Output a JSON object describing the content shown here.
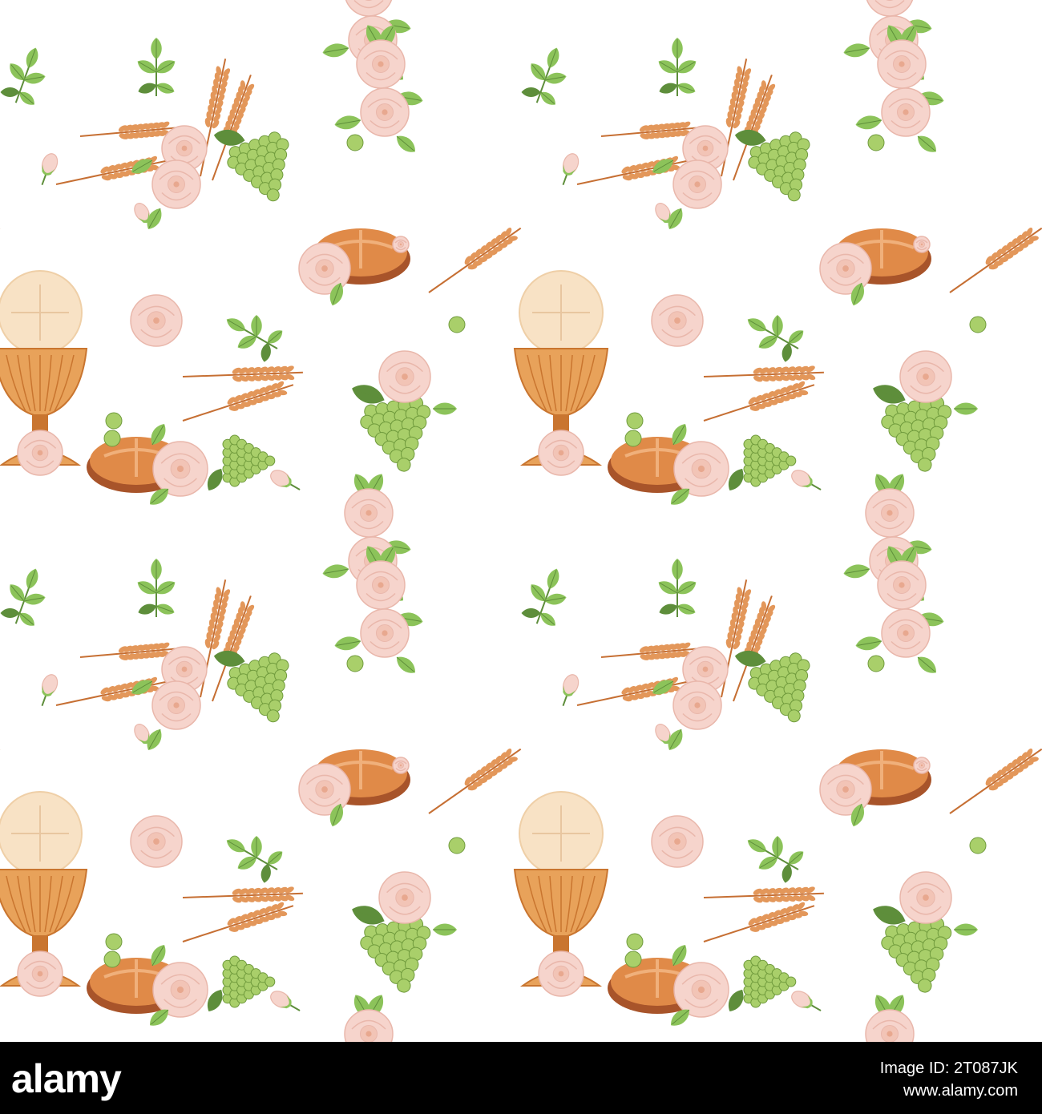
{
  "image": {
    "kind": "seamless-pattern",
    "motifs": [
      "chalice-with-host",
      "rose-bouquet",
      "bread-loaf",
      "wheat-ear",
      "grape-bunch",
      "rose-bud",
      "leaf-sprig",
      "single-grape"
    ]
  },
  "colors": {
    "background": "#ffffff",
    "rose": "#f6d4cc",
    "rose_shade": "#e9b7ab",
    "leaf": "#8cc35a",
    "leaf_dark": "#5e8e3b",
    "grape": "#a9cf6a",
    "grape_dark": "#6f9a3c",
    "wheat": "#e3975a",
    "wheat_dark": "#c66f33",
    "chalice": "#e8a25a",
    "chalice_dark": "#c9752f",
    "host": "#f8e2c5",
    "bread": "#e08a48",
    "bread_dark": "#a8542a",
    "footer": "#000000",
    "footer_text": "#ffffff"
  },
  "watermark": {
    "logo": "alamy",
    "image_id": "Image ID: 2T087JK",
    "url": "www.alamy.com"
  }
}
